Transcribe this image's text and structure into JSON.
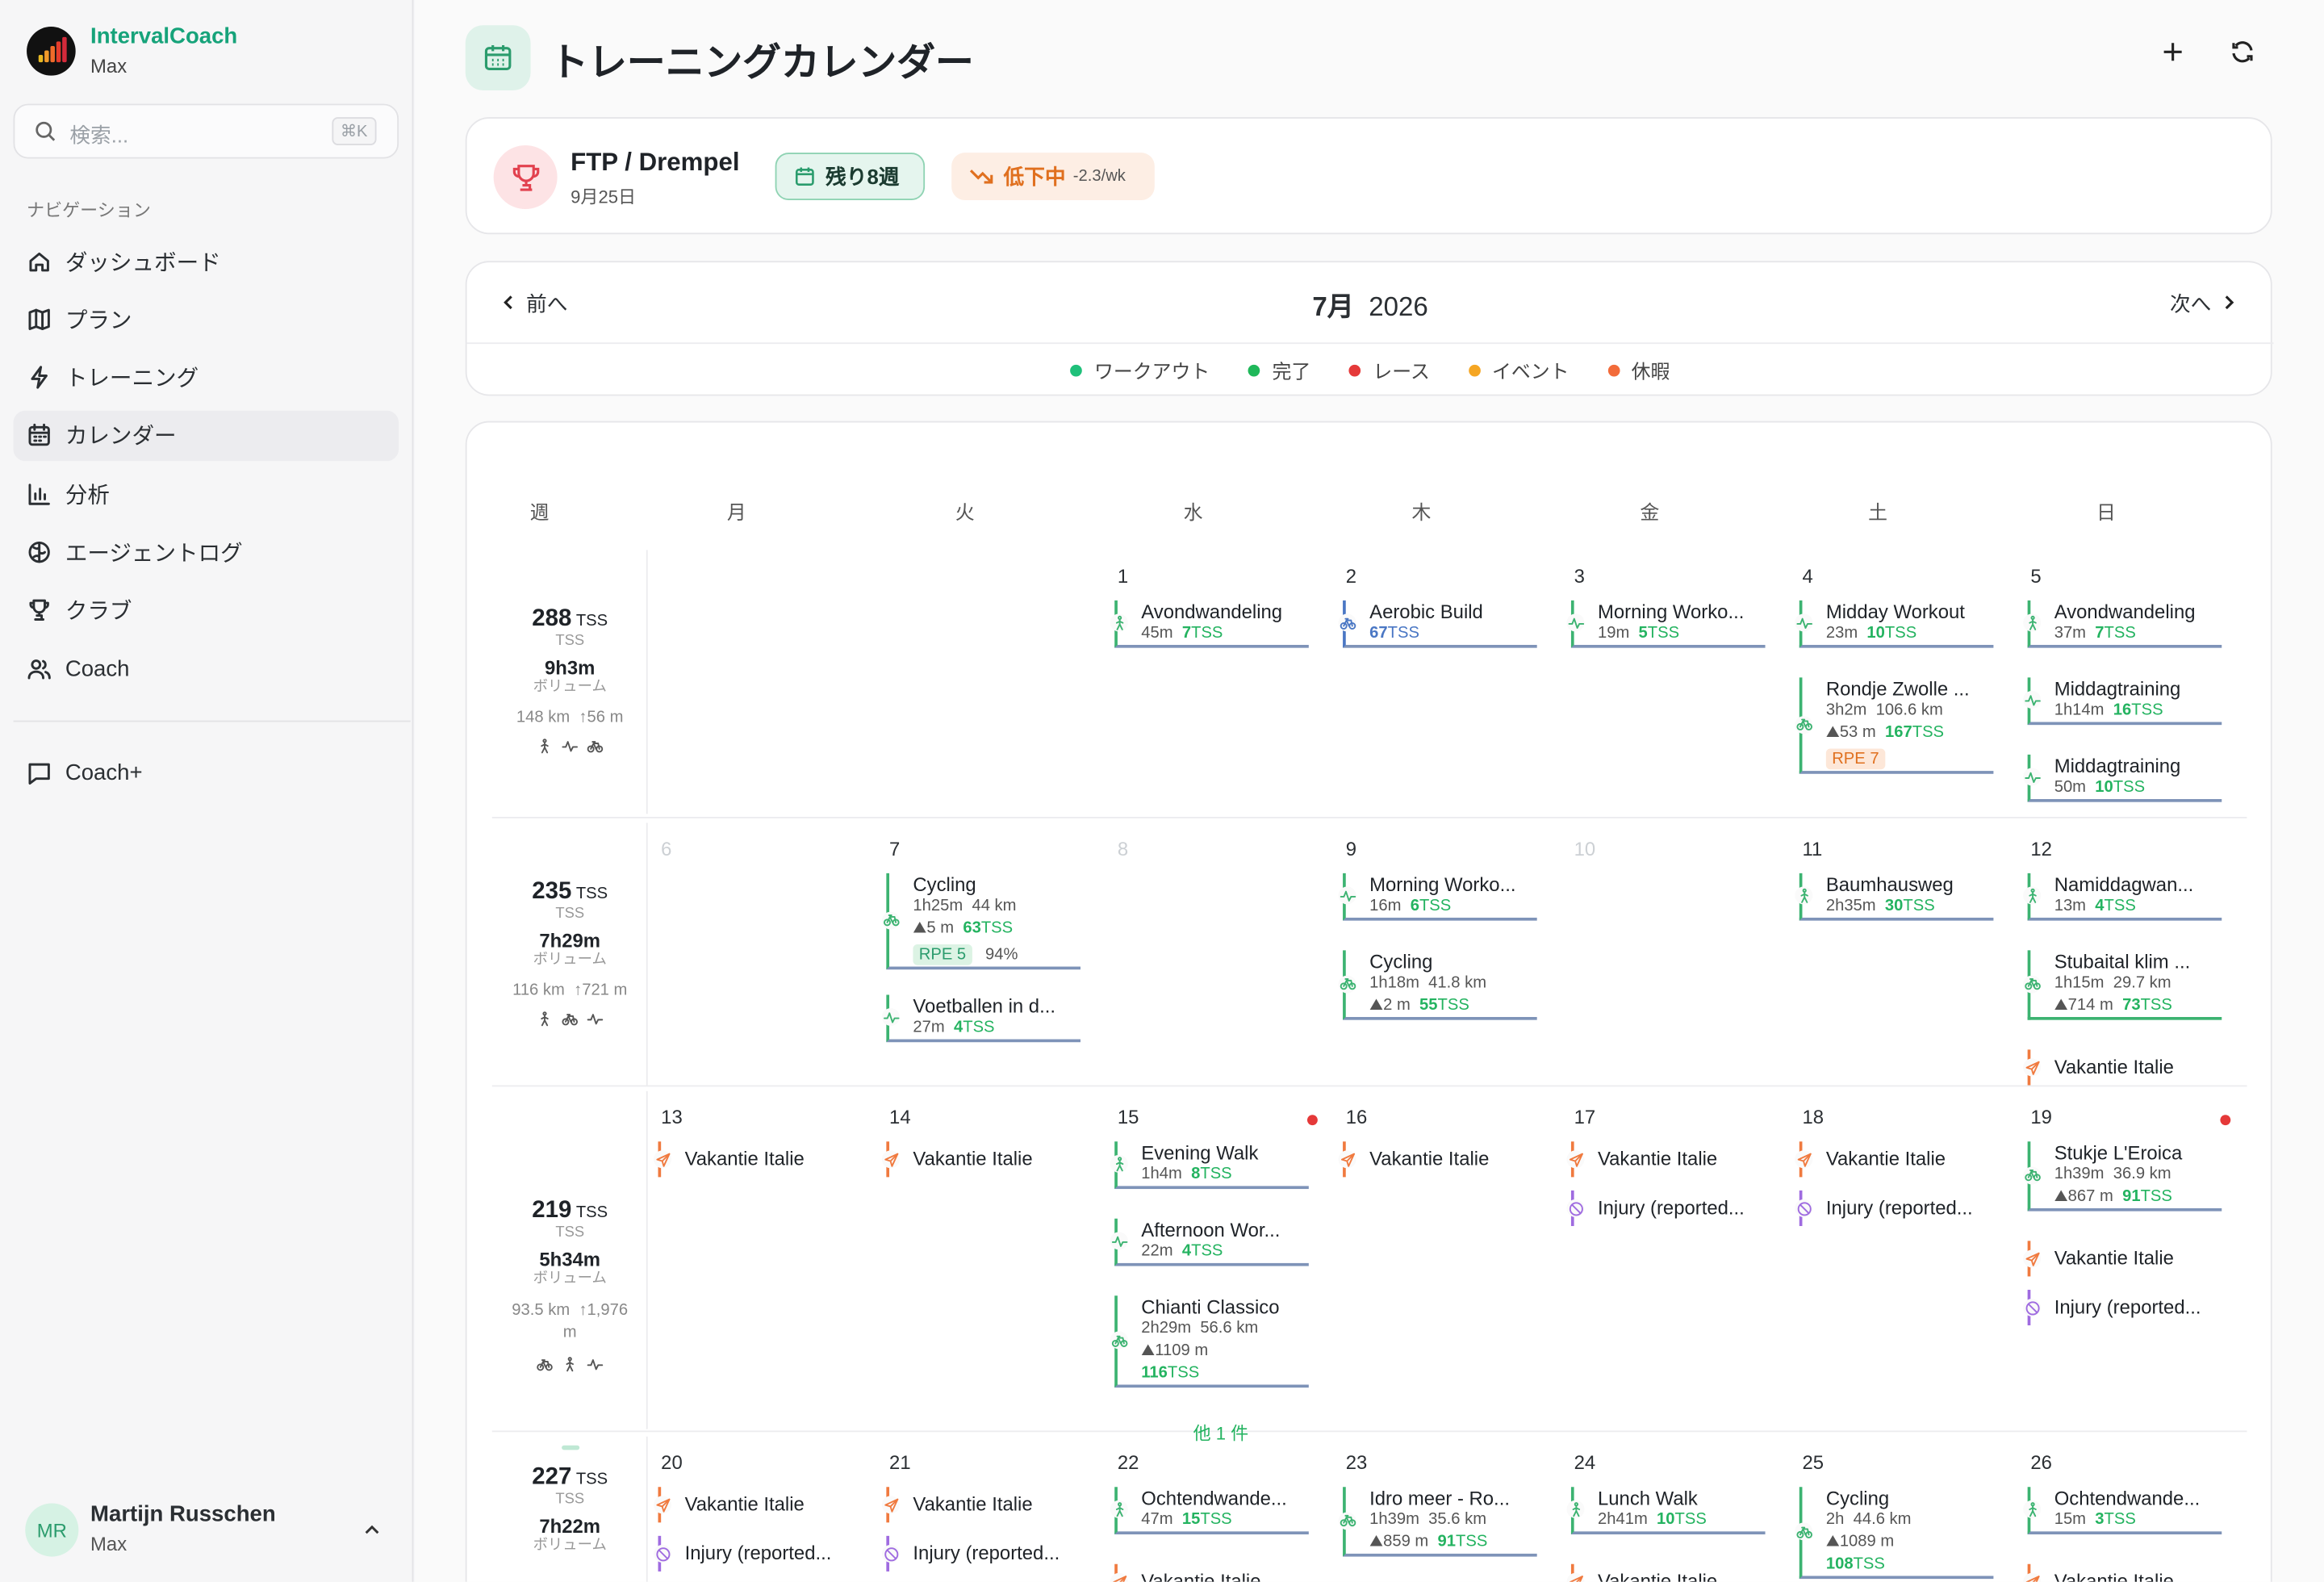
{
  "app": {
    "name": "IntervalCoach",
    "user_short": "Max"
  },
  "search": {
    "placeholder": "検索...",
    "shortcut": "⌘K"
  },
  "nav": {
    "heading": "ナビゲーション",
    "items": [
      {
        "label": "ダッシュボード",
        "icon": "home-icon"
      },
      {
        "label": "プラン",
        "icon": "map-icon"
      },
      {
        "label": "トレーニング",
        "icon": "bolt-icon"
      },
      {
        "label": "カレンダー",
        "icon": "calendar-icon",
        "active": true
      },
      {
        "label": "分析",
        "icon": "chart-icon"
      },
      {
        "label": "エージェントログ",
        "icon": "brain-icon"
      },
      {
        "label": "クラブ",
        "icon": "trophy-icon"
      },
      {
        "label": "Coach",
        "icon": "users-icon"
      }
    ],
    "extra": {
      "label": "Coach+",
      "icon": "chat-icon"
    }
  },
  "user": {
    "initials": "MR",
    "name": "Martijn Russchen",
    "sub": "Max"
  },
  "page": {
    "title": "トレーニングカレンダー"
  },
  "goal": {
    "title": "FTP / Drempel",
    "date": "9月25日",
    "weeks_left": "残り8週",
    "trend": "低下中",
    "trend_rate": "-2.3/wk"
  },
  "calendar": {
    "prev": "前へ",
    "next": "次へ",
    "month": "7月",
    "year": "2026",
    "legend": [
      {
        "label": "ワークアウト",
        "color": "#1fc07a"
      },
      {
        "label": "完了",
        "color": "#1fb85a"
      },
      {
        "label": "レース",
        "color": "#e53939"
      },
      {
        "label": "イベント",
        "color": "#f5a623"
      },
      {
        "label": "休暇",
        "color": "#f26b3a"
      }
    ],
    "headers": [
      "週",
      "月",
      "火",
      "水",
      "木",
      "金",
      "土",
      "日"
    ],
    "more_label": "他 1 件"
  },
  "colors": {
    "accent": "#16a37a",
    "completed": "#24b360",
    "vacation": "#f07a3f",
    "injury": "#9f6be0",
    "ride": "#4a77c4"
  },
  "weeks": [
    {
      "tss": "288",
      "tss_unit": "TSS",
      "tss_lbl": "TSS",
      "vol": "9h3m",
      "vol_lbl": "ボリューム",
      "dist": "148 km",
      "elev": "56 m",
      "icons": [
        "walk-icon",
        "pulse-icon",
        "bike-icon"
      ],
      "days": [
        {
          "n": "",
          "ev": []
        },
        {
          "n": "",
          "ev": []
        },
        {
          "n": "1",
          "ev": [
            {
              "t": "w",
              "icon": "walk-icon",
              "name": "Avondwandeling",
              "lines": [
                [
                  [
                    "45m"
                  ],
                  [
                    "7",
                    "b"
                  ],
                  [
                    "TSS",
                    "e"
                  ]
                ]
              ]
            }
          ]
        },
        {
          "n": "2",
          "ev": [
            {
              "t": "r",
              "icon": "bike-icon",
              "name": "Aerobic Build",
              "lines": [
                [
                  [
                    "67",
                    "bb"
                  ],
                  [
                    "TSS",
                    "eb"
                  ]
                ]
              ]
            }
          ]
        },
        {
          "n": "3",
          "ev": [
            {
              "t": "w",
              "icon": "pulse-icon",
              "name": "Morning Worko...",
              "lines": [
                [
                  [
                    "19m"
                  ],
                  [
                    "5",
                    "b"
                  ],
                  [
                    "TSS",
                    "e"
                  ]
                ]
              ]
            }
          ]
        },
        {
          "n": "4",
          "ev": [
            {
              "t": "w",
              "icon": "pulse-icon",
              "name": "Midday Workout",
              "lines": [
                [
                  [
                    "23m"
                  ],
                  [
                    "10",
                    "b"
                  ],
                  [
                    "TSS",
                    "e"
                  ]
                ]
              ]
            },
            {
              "t": "w",
              "icon": "bike-icon",
              "name": "Rondje Zwolle ...",
              "lines": [
                [
                  [
                    "3h2m"
                  ],
                  [
                    "106.6 km"
                  ]
                ],
                [
                  [
                    "⛰53 m"
                  ],
                  [
                    "167",
                    "b"
                  ],
                  [
                    "TSS",
                    "e"
                  ]
                ]
              ],
              "rpe": "RPE 7"
            }
          ]
        },
        {
          "n": "5",
          "ev": [
            {
              "t": "w",
              "icon": "walk-icon",
              "name": "Avondwandeling",
              "lines": [
                [
                  [
                    "37m"
                  ],
                  [
                    "7",
                    "b"
                  ],
                  [
                    "TSS",
                    "e"
                  ]
                ]
              ]
            },
            {
              "t": "w",
              "icon": "pulse-icon",
              "name": "Middagtraining",
              "lines": [
                [
                  [
                    "1h14m"
                  ],
                  [
                    "16",
                    "b"
                  ],
                  [
                    "TSS",
                    "e"
                  ]
                ]
              ]
            },
            {
              "t": "w",
              "icon": "pulse-icon",
              "name": "Middagtraining",
              "lines": [
                [
                  [
                    "50m"
                  ],
                  [
                    "10",
                    "b"
                  ],
                  [
                    "TSS",
                    "e"
                  ]
                ]
              ]
            }
          ]
        }
      ]
    },
    {
      "tss": "235",
      "tss_unit": "TSS",
      "tss_lbl": "TSS",
      "vol": "7h29m",
      "vol_lbl": "ボリューム",
      "dist": "116 km",
      "elev": "721 m",
      "icons": [
        "walk-icon",
        "bike-icon",
        "pulse-icon"
      ],
      "days": [
        {
          "n": "6",
          "faded": true,
          "ev": []
        },
        {
          "n": "7",
          "ev": [
            {
              "t": "w",
              "icon": "bike-icon",
              "name": "Cycling",
              "lines": [
                [
                  [
                    "1h25m"
                  ],
                  [
                    "44 km"
                  ]
                ],
                [
                  [
                    "⛰5 m"
                  ],
                  [
                    "63",
                    "b"
                  ],
                  [
                    "TSS",
                    "e"
                  ]
                ]
              ],
              "rpe": "RPE 5",
              "rpe_g": true,
              "extra": "94%"
            },
            {
              "t": "w",
              "icon": "pulse-icon",
              "name": "Voetballen in d...",
              "lines": [
                [
                  [
                    "27m"
                  ],
                  [
                    "4",
                    "b"
                  ],
                  [
                    "TSS",
                    "e"
                  ]
                ]
              ]
            }
          ]
        },
        {
          "n": "8",
          "faded": true,
          "ev": []
        },
        {
          "n": "9",
          "ev": [
            {
              "t": "w",
              "icon": "pulse-icon",
              "name": "Morning Worko...",
              "lines": [
                [
                  [
                    "16m"
                  ],
                  [
                    "6",
                    "b"
                  ],
                  [
                    "TSS",
                    "e"
                  ]
                ]
              ]
            },
            {
              "t": "w",
              "icon": "bike-icon",
              "name": "Cycling",
              "lines": [
                [
                  [
                    "1h18m"
                  ],
                  [
                    "41.8 km"
                  ]
                ],
                [
                  [
                    "⛰2 m"
                  ],
                  [
                    "55",
                    "b"
                  ],
                  [
                    "TSS",
                    "e"
                  ]
                ]
              ]
            }
          ]
        },
        {
          "n": "10",
          "faded": true,
          "ev": []
        },
        {
          "n": "11",
          "ev": [
            {
              "t": "w",
              "icon": "walk-icon",
              "name": "Baumhausweg",
              "lines": [
                [
                  [
                    "2h35m"
                  ],
                  [
                    "30",
                    "b"
                  ],
                  [
                    "TSS",
                    "e"
                  ]
                ]
              ]
            }
          ]
        },
        {
          "n": "12",
          "ev": [
            {
              "t": "w",
              "icon": "walk-icon",
              "name": "Namiddagwan...",
              "lines": [
                [
                  [
                    "13m"
                  ],
                  [
                    "4",
                    "b"
                  ],
                  [
                    "TSS",
                    "e"
                  ]
                ]
              ]
            },
            {
              "t": "w",
              "icon": "bike-icon",
              "name": "Stubaital klim ...",
              "lines": [
                [
                  [
                    "1h15m"
                  ],
                  [
                    "29.7 km"
                  ]
                ],
                [
                  [
                    "⛰714 m"
                  ],
                  [
                    "73",
                    "b"
                  ],
                  [
                    "TSS",
                    "e"
                  ]
                ]
              ],
              "uline": "g"
            },
            {
              "t": "v",
              "icon": "plane-icon",
              "name": "Vakantie Italie"
            }
          ]
        }
      ]
    },
    {
      "tss": "219",
      "tss_unit": "TSS",
      "tss_lbl": "TSS",
      "vol": "5h34m",
      "vol_lbl": "ボリューム",
      "dist": "93.5 km",
      "elev": "1,976 m",
      "icons": [
        "bike-icon",
        "walk-icon",
        "pulse-icon"
      ],
      "days": [
        {
          "n": "13",
          "ev": [
            {
              "t": "v",
              "icon": "plane-icon",
              "name": "Vakantie Italie"
            }
          ]
        },
        {
          "n": "14",
          "ev": [
            {
              "t": "v",
              "icon": "plane-icon",
              "name": "Vakantie Italie"
            }
          ]
        },
        {
          "n": "15",
          "dot": true,
          "more": true,
          "ev": [
            {
              "t": "w",
              "icon": "walk-icon",
              "name": "Evening Walk",
              "lines": [
                [
                  [
                    "1h4m"
                  ],
                  [
                    "8",
                    "b"
                  ],
                  [
                    "TSS",
                    "e"
                  ]
                ]
              ]
            },
            {
              "t": "w",
              "icon": "pulse-icon",
              "name": "Afternoon Wor...",
              "lines": [
                [
                  [
                    "22m"
                  ],
                  [
                    "4",
                    "b"
                  ],
                  [
                    "TSS",
                    "e"
                  ]
                ]
              ]
            },
            {
              "t": "w",
              "icon": "bike-icon",
              "name": "Chianti Classico",
              "lines": [
                [
                  [
                    "2h29m"
                  ],
                  [
                    "56.6 km"
                  ]
                ],
                [
                  [
                    "⛰1109 m"
                  ]
                ],
                [
                  [
                    "116",
                    "b"
                  ],
                  [
                    "TSS",
                    "e"
                  ]
                ]
              ]
            }
          ]
        },
        {
          "n": "16",
          "ev": [
            {
              "t": "v",
              "icon": "plane-icon",
              "name": "Vakantie Italie"
            }
          ]
        },
        {
          "n": "17",
          "ev": [
            {
              "t": "v",
              "icon": "plane-icon",
              "name": "Vakantie Italie"
            },
            {
              "t": "i",
              "icon": "ban-icon",
              "name": "Injury (reported..."
            }
          ]
        },
        {
          "n": "18",
          "ev": [
            {
              "t": "v",
              "icon": "plane-icon",
              "name": "Vakantie Italie"
            },
            {
              "t": "i",
              "icon": "ban-icon",
              "name": "Injury (reported..."
            }
          ]
        },
        {
          "n": "19",
          "dot": true,
          "ev": [
            {
              "t": "w",
              "icon": "bike-icon",
              "name": "Stukje L'Eroica",
              "lines": [
                [
                  [
                    "1h39m"
                  ],
                  [
                    "36.9 km"
                  ]
                ],
                [
                  [
                    "⛰867 m"
                  ],
                  [
                    "91",
                    "b"
                  ],
                  [
                    "TSS",
                    "e"
                  ]
                ]
              ]
            },
            {
              "t": "v",
              "icon": "plane-icon",
              "name": "Vakantie Italie"
            },
            {
              "t": "i",
              "icon": "ban-icon",
              "name": "Injury (reported..."
            }
          ]
        }
      ]
    },
    {
      "tss": "227",
      "tss_unit": "TSS",
      "tss_lbl": "TSS",
      "vol": "7h22m",
      "vol_lbl": "ボリューム",
      "dist": "",
      "elev": "",
      "icons": [],
      "days": [
        {
          "n": "20",
          "ev": [
            {
              "t": "v",
              "icon": "plane-icon",
              "name": "Vakantie Italie"
            },
            {
              "t": "i",
              "icon": "ban-icon",
              "name": "Injury (reported..."
            }
          ]
        },
        {
          "n": "21",
          "ev": [
            {
              "t": "v",
              "icon": "plane-icon",
              "name": "Vakantie Italie"
            },
            {
              "t": "i",
              "icon": "ban-icon",
              "name": "Injury (reported..."
            }
          ]
        },
        {
          "n": "22",
          "ev": [
            {
              "t": "w",
              "icon": "walk-icon",
              "name": "Ochtendwande...",
              "lines": [
                [
                  [
                    "47m"
                  ],
                  [
                    "15",
                    "b"
                  ],
                  [
                    "TSS",
                    "e"
                  ]
                ]
              ]
            },
            {
              "t": "v",
              "icon": "plane-icon",
              "name": "Vakantie Italie"
            }
          ]
        },
        {
          "n": "23",
          "ev": [
            {
              "t": "w",
              "icon": "bike-icon",
              "name": "Idro meer - Ro...",
              "lines": [
                [
                  [
                    "1h39m"
                  ],
                  [
                    "35.6 km"
                  ]
                ],
                [
                  [
                    "⛰859 m"
                  ],
                  [
                    "91",
                    "b"
                  ],
                  [
                    "TSS",
                    "e"
                  ]
                ]
              ]
            }
          ]
        },
        {
          "n": "24",
          "ev": [
            {
              "t": "w",
              "icon": "walk-icon",
              "name": "Lunch Walk",
              "lines": [
                [
                  [
                    "2h41m"
                  ],
                  [
                    "10",
                    "b"
                  ],
                  [
                    "TSS",
                    "e"
                  ]
                ]
              ]
            },
            {
              "t": "v",
              "icon": "plane-icon",
              "name": "Vakantie Italie"
            }
          ]
        },
        {
          "n": "25",
          "ev": [
            {
              "t": "w",
              "icon": "bike-icon",
              "name": "Cycling",
              "lines": [
                [
                  [
                    "2h"
                  ],
                  [
                    "44.6 km"
                  ]
                ],
                [
                  [
                    "⛰1089 m"
                  ]
                ],
                [
                  [
                    "108",
                    "b"
                  ],
                  [
                    "TSS",
                    "e"
                  ]
                ]
              ]
            }
          ]
        },
        {
          "n": "26",
          "ev": [
            {
              "t": "w",
              "icon": "walk-icon",
              "name": "Ochtendwande...",
              "lines": [
                [
                  [
                    "15m"
                  ],
                  [
                    "3",
                    "b"
                  ],
                  [
                    "TSS",
                    "e"
                  ]
                ]
              ]
            },
            {
              "t": "v",
              "icon": "plane-icon",
              "name": "Vakantie Italie"
            }
          ]
        }
      ]
    }
  ]
}
